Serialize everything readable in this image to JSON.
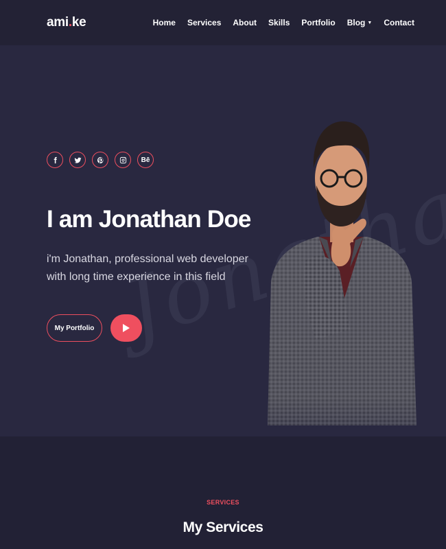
{
  "header": {
    "logo_prefix": "ami",
    "logo_dot": ".",
    "logo_suffix": "ke",
    "nav": [
      {
        "label": "Home"
      },
      {
        "label": "Services"
      },
      {
        "label": "About"
      },
      {
        "label": "Skills"
      },
      {
        "label": "Portfolio"
      },
      {
        "label": "Blog",
        "has_dropdown": true
      },
      {
        "label": "Contact"
      }
    ]
  },
  "hero": {
    "socials": [
      {
        "icon": "facebook-icon"
      },
      {
        "icon": "twitter-icon"
      },
      {
        "icon": "pinterest-icon"
      },
      {
        "icon": "instagram-icon"
      },
      {
        "icon": "behance-icon",
        "text": "Bē"
      }
    ],
    "title": "I am Jonathan Doe",
    "description": "i'm Jonathan, professional web developer with long time experience in this field",
    "portfolio_button": "My Portfolio",
    "play_icon": "play-icon",
    "watermark": "Jonathan"
  },
  "services": {
    "eyebrow": "SERVICES",
    "title": "My Services"
  },
  "colors": {
    "accent": "#ef4f5f",
    "background": "#222135",
    "hero_background": "#292840"
  }
}
